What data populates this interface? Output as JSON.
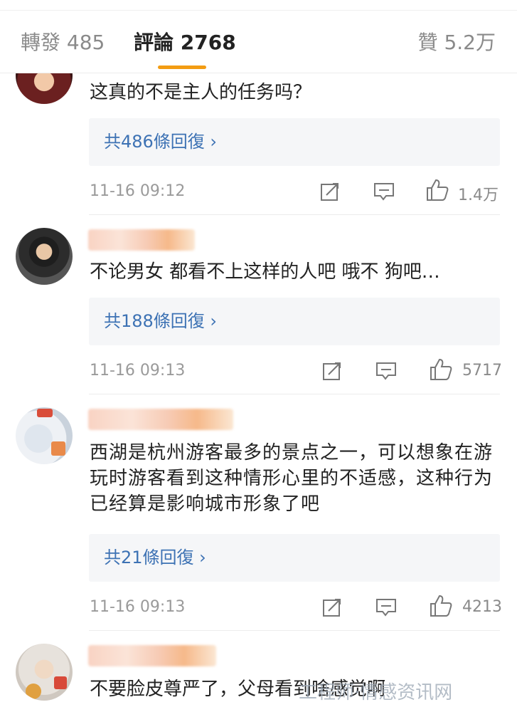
{
  "tabs": {
    "repost": "轉發 485",
    "comments": "評論 2768",
    "likes": "贊 5.2万"
  },
  "accent_color": "#f39c12",
  "link_color": "#3d72b4",
  "comments": [
    {
      "text": "这真的不是主人的任务吗？",
      "replies": "共486條回復 ›",
      "time": "11-16 09:12",
      "likes": "1.4万"
    },
    {
      "text": "不论男女 都看不上这样的人吧 哦不   狗吧…",
      "replies": "共188條回復 ›",
      "time": "11-16 09:13",
      "likes": "5717"
    },
    {
      "text": "西湖是杭州游客最多的景点之一，可以想象在游玩时游客看到这种情形心里的不适感，这种行为已经算是影响城市形象了吧",
      "replies": "共21條回復 ›",
      "time": "11-16 09:13",
      "likes": "4213"
    },
    {
      "text": "不要脸皮尊严了，父母看到啥感觉啊"
    }
  ],
  "icons": [
    "share-icon",
    "comment-icon",
    "thumbs-up-icon"
  ],
  "watermark": "工程师·情感资讯网"
}
